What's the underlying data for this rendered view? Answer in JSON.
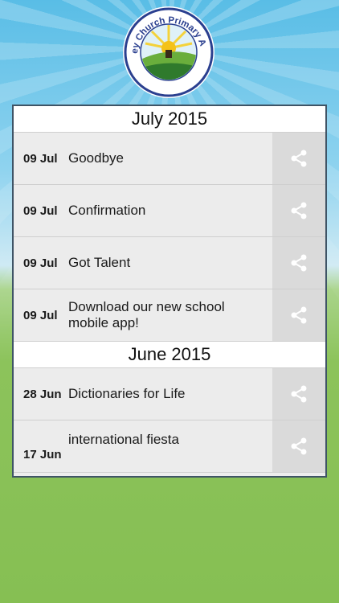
{
  "logo": {
    "text": "Hawkesley Church Primary Academy"
  },
  "sections": [
    {
      "month": "July 2015",
      "items": [
        {
          "date": "09 Jul",
          "title": "Goodbye"
        },
        {
          "date": "09 Jul",
          "title": "Confirmation"
        },
        {
          "date": "09 Jul",
          "title": "Got Talent"
        },
        {
          "date": "09 Jul",
          "title": "Download our new school mobile app!"
        }
      ]
    },
    {
      "month": "June 2015",
      "items": [
        {
          "date": "28 Jun",
          "title": "Dictionaries for Life"
        },
        {
          "date": "17 Jun",
          "title": "international fiesta"
        }
      ]
    }
  ],
  "icons": {
    "share": "share-icon"
  },
  "colors": {
    "panel_border": "#3f5466",
    "row_bg": "#ececec",
    "share_bg": "#dadada",
    "sky": "#59bde6",
    "grass": "#8cc35b"
  }
}
